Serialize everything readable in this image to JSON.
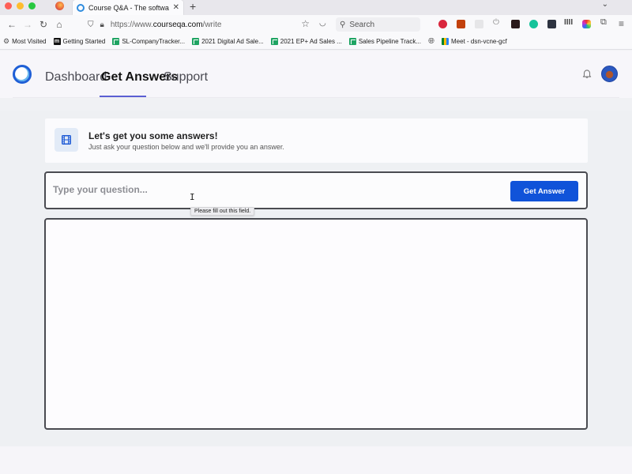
{
  "browser": {
    "tab": {
      "title": "Course Q&A - The software bui",
      "close_glyph": "✕"
    },
    "new_tab_glyph": "+",
    "tab_list_glyph": "⌄",
    "nav": {
      "back_glyph": "←",
      "forward_glyph": "→",
      "reload_glyph": "↻",
      "home_glyph": "⌂"
    },
    "url": {
      "prefix": "https://www.",
      "domain": "courseqa.com",
      "path": "/write"
    },
    "search_placeholder": "Search",
    "extensions": [
      {
        "name": "adblock-icon",
        "color": "#d9263d"
      },
      {
        "name": "extension-orange-icon",
        "color": "#c2410c"
      },
      {
        "name": "extension-blank-icon",
        "color": "#e6e6e8"
      },
      {
        "name": "power-icon",
        "color": "#f9f9fb"
      },
      {
        "name": "acrobat-icon",
        "color": "#2b1a1a"
      },
      {
        "name": "grammarly-icon",
        "color": "#15c39a"
      },
      {
        "name": "extension-dark-icon",
        "color": "#2d3340"
      },
      {
        "name": "extension-bars-icon",
        "color": "#f9f9fb"
      },
      {
        "name": "extension-colorful-icon",
        "color": "#6a3fd0"
      },
      {
        "name": "puzzle-extensions-icon",
        "color": "#f9f9fb"
      }
    ],
    "menu_glyph": "≡",
    "bookmarks": [
      {
        "label": "Most Visited",
        "icon": "gear"
      },
      {
        "label": "Getting Started",
        "icon": "m"
      },
      {
        "label": "SL-CompanyTracker...",
        "icon": "sheet"
      },
      {
        "label": "2021 Digital Ad Sale...",
        "icon": "sheet"
      },
      {
        "label": "2021 EP+ Ad Sales ...",
        "icon": "sheet"
      },
      {
        "label": "Sales Pipeline Track...",
        "icon": "sheet"
      },
      {
        "label": "",
        "icon": "globe"
      },
      {
        "label": "Meet - dsn-vcne-gcf",
        "icon": "meet"
      }
    ]
  },
  "app": {
    "nav": {
      "dashboard": "Dashboard",
      "get_answers": "Get Answers",
      "support": "Support"
    },
    "accent_color": "#5b5fd3",
    "intro": {
      "title": "Let's get you some answers!",
      "subtitle": "Just ask your question below and we'll provide you an answer."
    },
    "question": {
      "placeholder": "Type your question...",
      "value": ""
    },
    "get_answer_label": "Get Answer",
    "button_color": "#1053d9",
    "validation_tooltip": "Please fill out this field.",
    "answer": ""
  }
}
